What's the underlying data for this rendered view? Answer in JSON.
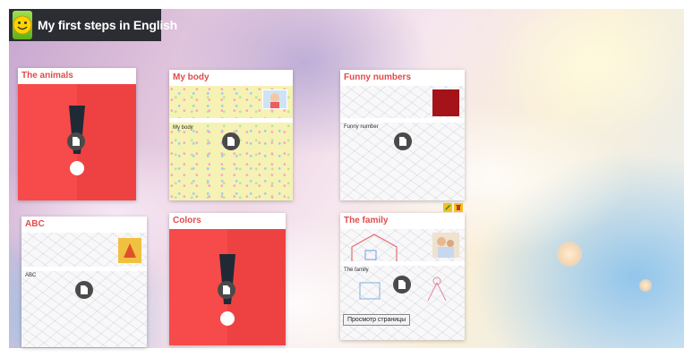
{
  "app": {
    "title": "My first steps in English",
    "logo": "smiley-logo"
  },
  "cards": [
    {
      "title": "The animals",
      "style": "red",
      "icon": "exclamation-icon"
    },
    {
      "title": "My body",
      "subtitle": "My body",
      "style": "yellow-pattern",
      "icon": "document-icon"
    },
    {
      "title": "Funny numbers",
      "subtitle": "Funny number",
      "style": "white-pattern",
      "icon": "document-icon"
    },
    {
      "title": "ABC",
      "subtitle": "ABC",
      "style": "white-pattern",
      "icon": "document-icon"
    },
    {
      "title": "Colors",
      "style": "red",
      "icon": "exclamation-icon"
    },
    {
      "title": "The family",
      "subtitle": "The family",
      "style": "white-pattern",
      "icon": "document-icon",
      "actions": [
        "edit-icon",
        "delete-icon"
      ]
    }
  ],
  "tooltip": {
    "text": "Просмотр страницы"
  },
  "colors": {
    "header_bg": "#2b2d32",
    "card_title": "#e14b4b",
    "red_card": "#f74a4a",
    "action_button": "#f0c020"
  }
}
